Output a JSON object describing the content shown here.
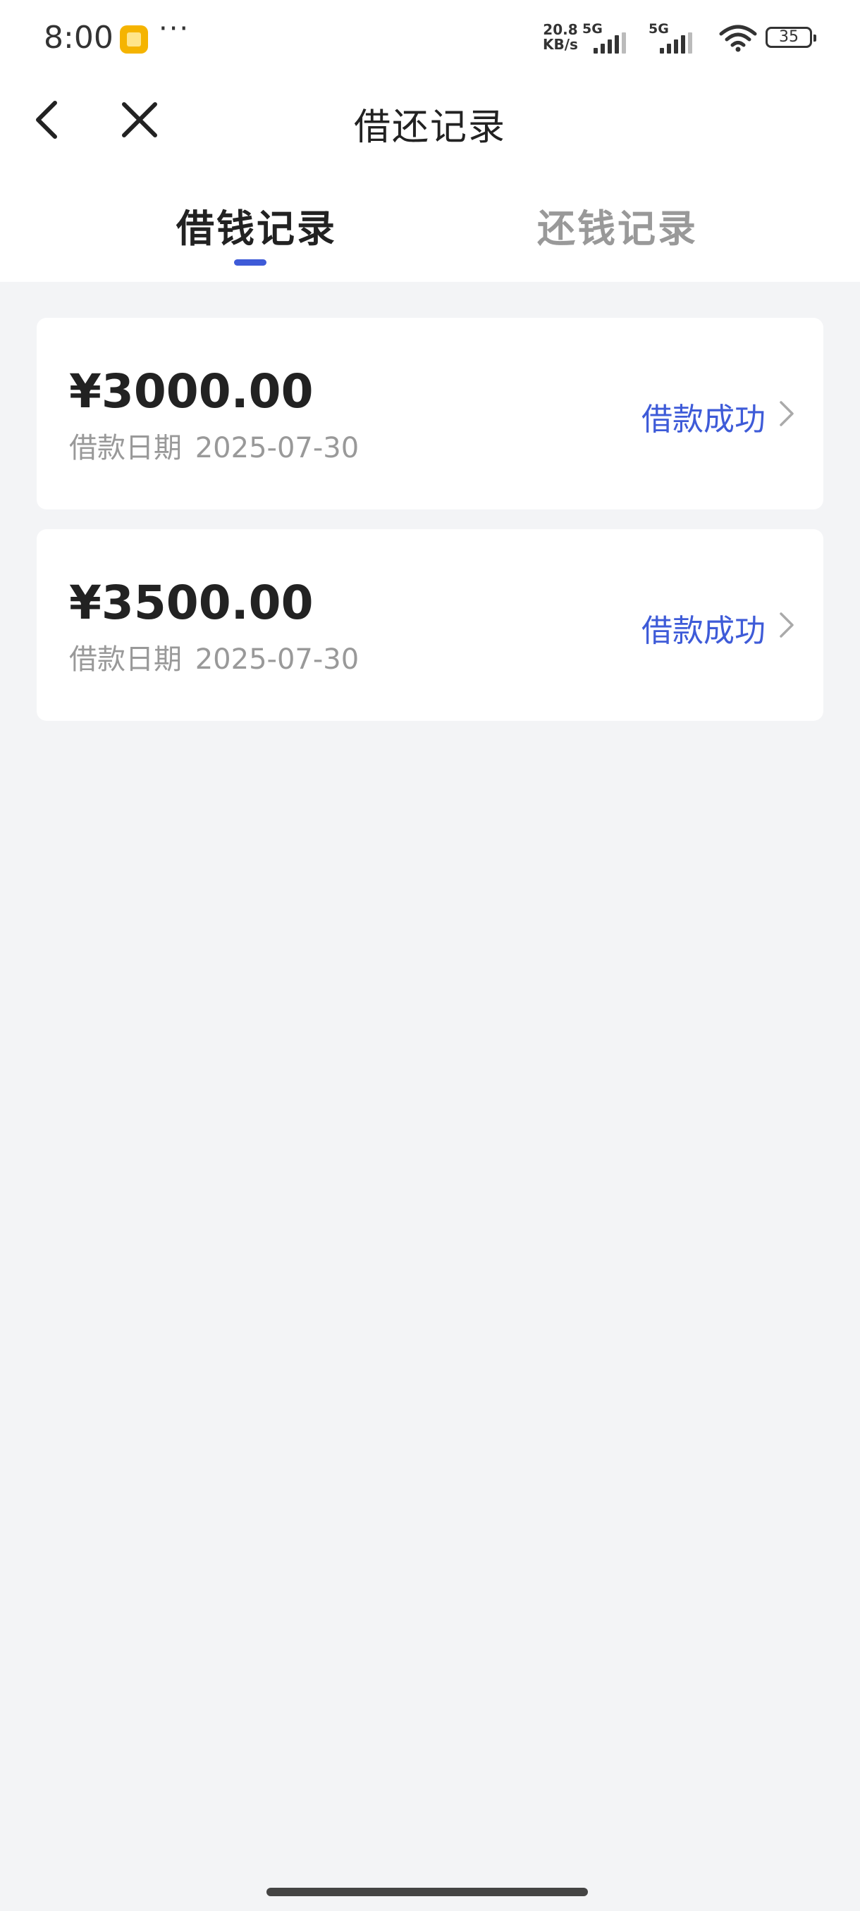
{
  "status_bar": {
    "time": "8:00",
    "more": "···",
    "net_speed_value": "20.8",
    "net_speed_unit": "KB/s",
    "signal_1_label": "5G",
    "signal_2_label": "5G",
    "battery": "35",
    "icons": [
      "app-notification-icon",
      "signal-icon",
      "wifi-icon",
      "battery-icon"
    ]
  },
  "nav": {
    "title": "借还记录",
    "back_icon": "back-arrow-icon",
    "close_icon": "close-icon"
  },
  "tabs": [
    {
      "label": "借钱记录",
      "active": true
    },
    {
      "label": "还钱记录",
      "active": false
    }
  ],
  "records": [
    {
      "amount": "¥3000.00",
      "date_label": "借款日期",
      "date": "2025-07-30",
      "status": "借款成功"
    },
    {
      "amount": "¥3500.00",
      "date_label": "借款日期",
      "date": "2025-07-30",
      "status": "借款成功"
    }
  ],
  "colors": {
    "accent": "#3e5bd8",
    "background": "#f3f4f6",
    "muted_text": "#999999"
  }
}
